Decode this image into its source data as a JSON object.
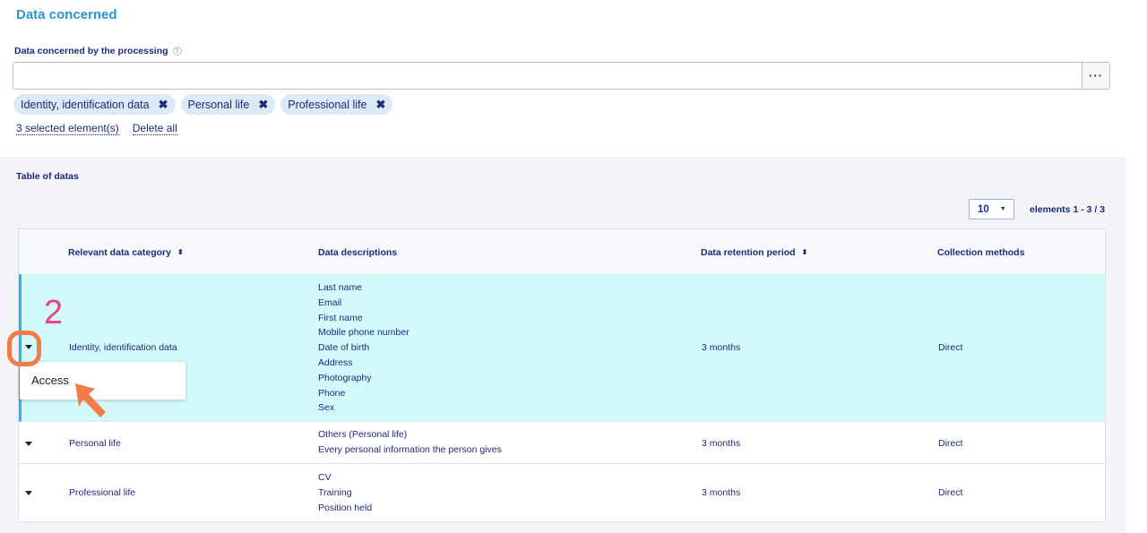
{
  "section_title": "Data concerned",
  "field": {
    "label": "Data concerned by the processing",
    "help_icon": "question-icon",
    "value": "",
    "more_label": "···"
  },
  "chips": [
    {
      "label": "Identity, identification data",
      "remove": "✖"
    },
    {
      "label": "Personal life",
      "remove": "✖"
    },
    {
      "label": "Professional life",
      "remove": "✖"
    }
  ],
  "selection": {
    "count_text": "3 selected element(s)",
    "delete_all": "Delete all"
  },
  "table_section": {
    "title": "Table of datas",
    "per_page": "10",
    "range": "elements 1 - 3 / 3"
  },
  "table": {
    "headers": {
      "category": "Relevant data category",
      "descriptions": "Data descriptions",
      "retention": "Data retention period",
      "methods": "Collection methods"
    },
    "sort_icon": "⬍",
    "rows": [
      {
        "category": "Identity, identification data",
        "descriptions": [
          "Last name",
          "Email",
          "First name",
          "Mobile phone number",
          "Date of birth",
          "Address",
          "Photography",
          "Phone",
          "Sex"
        ],
        "retention": "3 months",
        "method": "Direct"
      },
      {
        "category": "Personal life",
        "descriptions": [
          "Others (Personal life)",
          "Every personal information the person gives"
        ],
        "retention": "3 months",
        "method": "Direct"
      },
      {
        "category": "Professional life",
        "descriptions": [
          "CV",
          "Training",
          "Position held"
        ],
        "retention": "3 months",
        "method": "Direct"
      }
    ]
  },
  "dropdown": {
    "item": "Access"
  },
  "annotation": {
    "step_number": "2",
    "accent_color": "#f47a4a",
    "number_color": "#f0407a"
  },
  "colors": {
    "title": "#2696d3",
    "text": "#1c2a7a",
    "active_row": "#d2fafa",
    "active_border": "#2eb5e8",
    "chip_bg": "#dceaf6"
  }
}
